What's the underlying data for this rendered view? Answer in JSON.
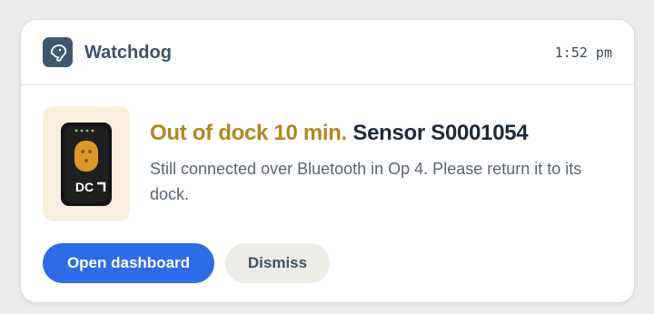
{
  "header": {
    "app_name": "Watchdog",
    "time": "1:52 pm",
    "icon": "dog-head-icon"
  },
  "notification": {
    "alert_text": "Out of dock 10 min.",
    "sensor_text": "Sensor S0001054",
    "body": "Still connected over Bluetooth in Op 4. Please return it to its dock.",
    "device_logo_text": "DC",
    "accent_color": "#b38622"
  },
  "actions": {
    "primary_label": "Open dashboard",
    "secondary_label": "Dismiss",
    "primary_color": "#2e6be6"
  }
}
